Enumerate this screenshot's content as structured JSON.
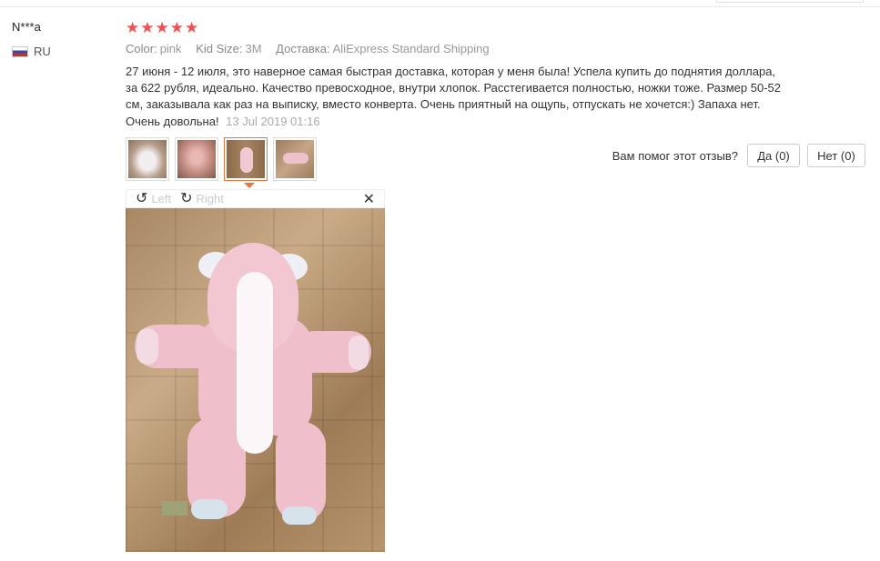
{
  "reviewer": {
    "name": "N***a",
    "country_code": "RU",
    "flag_icon": "russia-flag-icon"
  },
  "rating": {
    "stars": 5,
    "max": 5,
    "color": "#f0504f"
  },
  "attributes": [
    {
      "label": "Color:",
      "value": "pink"
    },
    {
      "label": "Kid Size:",
      "value": "3M"
    },
    {
      "label": "Доставка:",
      "value": "AliExpress Standard Shipping"
    }
  ],
  "review": {
    "text": "27 июня - 12 июля, это наверное самая быстрая доставка, которая у меня была! Успела купить до поднятия доллара, за 622 рубля, идеально. Качество превосходное, внутри хлопок. Расстегивается полностью, ножки тоже. Размер 50-52 см, заказывала как раз на выписку, вместо конверта. Очень приятный на ощупь, отпускать не хочется:) Запаха нет. Очень довольна!",
    "date": "13 Jul 2019 01:16"
  },
  "thumbnails": {
    "count": 4,
    "active_index": 2,
    "active_color": "#e8773e"
  },
  "helpful": {
    "question": "Вам помог этот отзыв?",
    "yes_label": "Да (0)",
    "no_label": "Нет (0)"
  },
  "viewer": {
    "rotate_left_label": "Left",
    "rotate_right_label": "Right",
    "rotate_left_icon": "rotate-left-icon",
    "rotate_right_icon": "rotate-right-icon",
    "close_icon": "close-icon"
  }
}
